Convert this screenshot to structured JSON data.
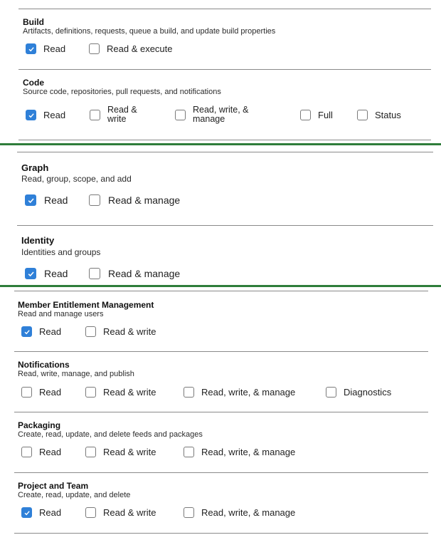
{
  "sections": [
    {
      "id": "build",
      "title": "Build",
      "description": "Artifacts, definitions, requests, queue a build, and update build properties",
      "options": [
        {
          "label": "Read",
          "checked": true
        },
        {
          "label": "Read & execute",
          "checked": false
        }
      ]
    },
    {
      "id": "code",
      "title": "Code",
      "description": "Source code, repositories, pull requests, and notifications",
      "options": [
        {
          "label": "Read",
          "checked": true
        },
        {
          "label": "Read &",
          "label2": "write",
          "checked": false
        },
        {
          "label": "Read, write, &",
          "label2": "manage",
          "checked": false
        },
        {
          "label": "Full",
          "checked": false
        },
        {
          "label": "Status",
          "checked": false
        }
      ]
    },
    {
      "id": "graph",
      "title": "Graph",
      "description": "Read, group, scope, and add",
      "options": [
        {
          "label": "Read",
          "checked": true
        },
        {
          "label": "Read & manage",
          "checked": false
        }
      ]
    },
    {
      "id": "identity",
      "title": "Identity",
      "description": "Identities and groups",
      "options": [
        {
          "label": "Read",
          "checked": true
        },
        {
          "label": "Read & manage",
          "checked": false
        }
      ]
    },
    {
      "id": "member-entitlement",
      "title": "Member Entitlement Management",
      "description": "Read and manage users",
      "options": [
        {
          "label": "Read",
          "checked": true
        },
        {
          "label": "Read & write",
          "checked": false
        }
      ]
    },
    {
      "id": "notifications",
      "title": "Notifications",
      "description": "Read, write, manage, and publish",
      "options": [
        {
          "label": "Read",
          "checked": false
        },
        {
          "label": "Read & write",
          "checked": false
        },
        {
          "label": "Read, write, & manage",
          "checked": false
        },
        {
          "label": "Diagnostics",
          "checked": false
        }
      ]
    },
    {
      "id": "packaging",
      "title": "Packaging",
      "description": "Create, read, update, and delete feeds and packages",
      "options": [
        {
          "label": "Read",
          "checked": false
        },
        {
          "label": "Read & write",
          "checked": false
        },
        {
          "label": "Read, write, & manage",
          "checked": false
        }
      ]
    },
    {
      "id": "project-team",
      "title": "Project and Team",
      "description": "Create, read, update, and delete",
      "options": [
        {
          "label": "Read",
          "checked": true
        },
        {
          "label": "Read & write",
          "checked": false
        },
        {
          "label": "Read, write, & manage",
          "checked": false
        }
      ]
    }
  ]
}
